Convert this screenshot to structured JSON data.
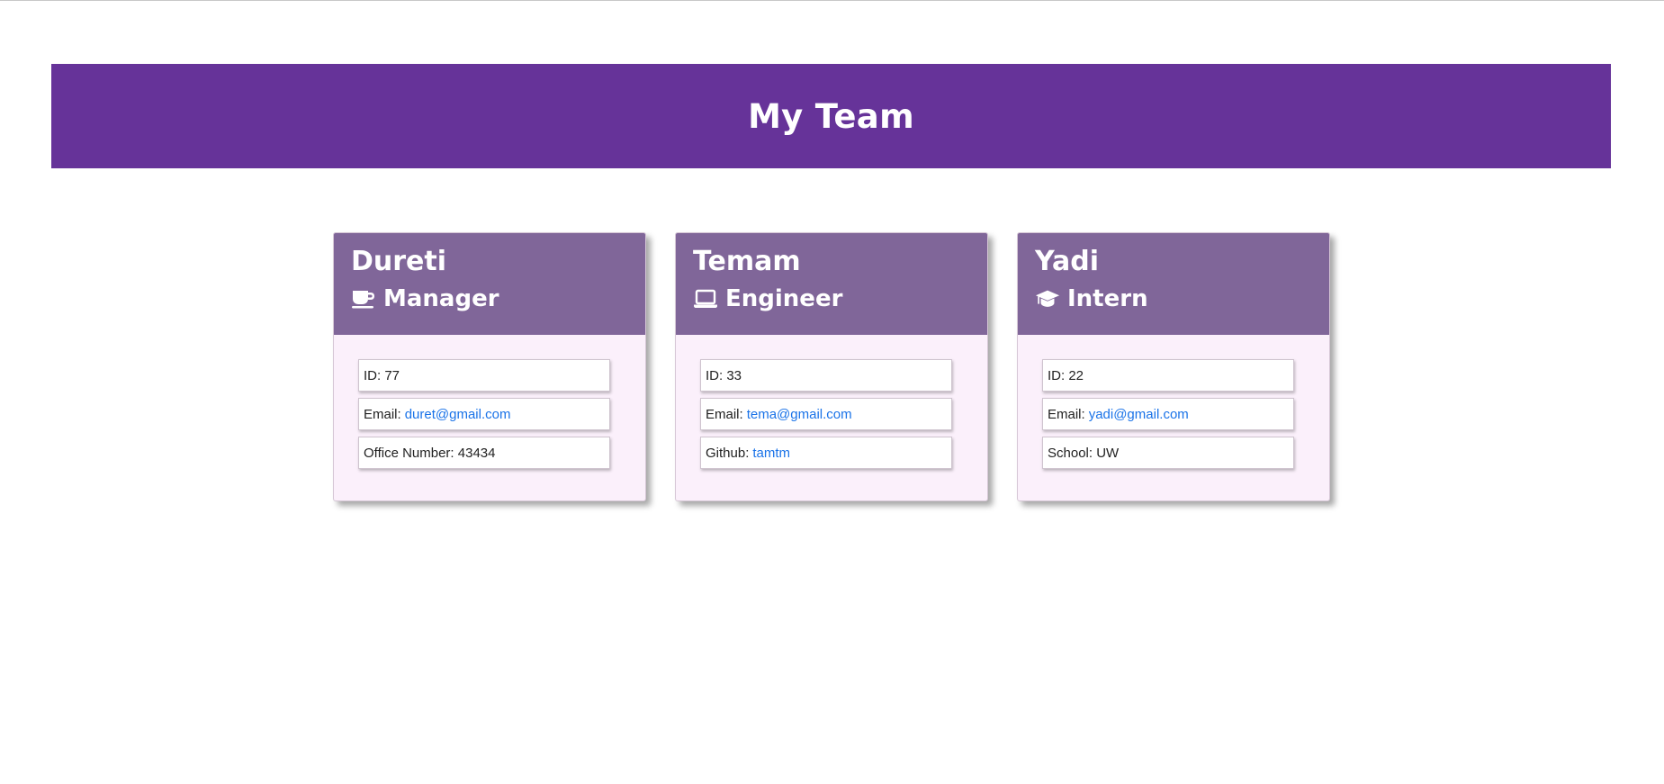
{
  "header": {
    "title": "My Team"
  },
  "colors": {
    "banner": "#663399",
    "card_header": "#806699",
    "card_body": "#fbf0fb",
    "link": "#1a73e8"
  },
  "team": [
    {
      "name": "Dureti",
      "role": "Manager",
      "role_icon": "coffee-cup-icon",
      "id_text": "ID: 77",
      "email_label": "Email:",
      "email": "duret@gmail.com",
      "extra_label": "Office Number: 43434",
      "extra_link": ""
    },
    {
      "name": "Temam",
      "role": "Engineer",
      "role_icon": "laptop-icon",
      "id_text": "ID: 33",
      "email_label": "Email:",
      "email": "tema@gmail.com",
      "extra_label": "Github:",
      "extra_link": "tamtm"
    },
    {
      "name": "Yadi",
      "role": "Intern",
      "role_icon": "graduation-cap-icon",
      "id_text": "ID: 22",
      "email_label": "Email:",
      "email": "yadi@gmail.com",
      "extra_label": "School: UW",
      "extra_link": ""
    }
  ]
}
